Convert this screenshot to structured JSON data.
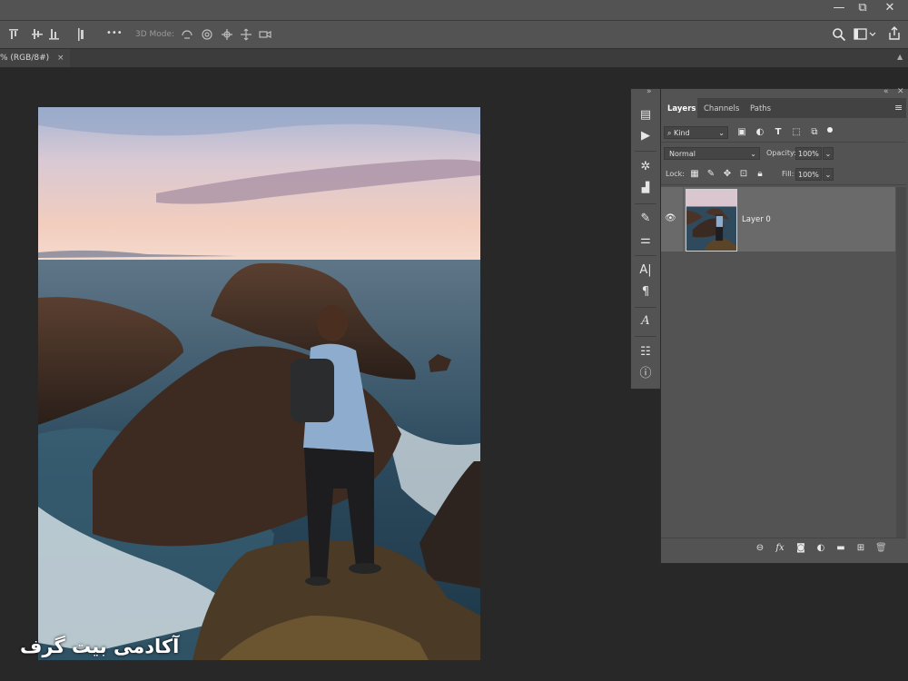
{
  "window": {
    "minimize": "—",
    "restore": "⧉",
    "close": "✕"
  },
  "options_bar": {
    "more_label": "•••",
    "mode_label": "3D Mode:"
  },
  "doc_tab": {
    "title": "% (RGB/8#)",
    "close": "×"
  },
  "panel_dock": {
    "collapse": "»",
    "items": [
      "history",
      "actions",
      "nav",
      "histogram",
      "brushes",
      "brush-settings",
      "character",
      "paragraph",
      "glyphs",
      "properties",
      "info"
    ]
  },
  "layers_panel": {
    "collapse": "«",
    "close": "✕",
    "menu": "≡",
    "tabs": [
      "Layers",
      "Channels",
      "Paths"
    ],
    "filter": {
      "kind": "Kind"
    },
    "blend_mode": "Normal",
    "opacity_label": "Opacity:",
    "opacity_value": "100%",
    "lock_label": "Lock:",
    "fill_label": "Fill:",
    "fill_value": "100%",
    "layers": [
      {
        "name": "Layer 0",
        "visible": true
      }
    ]
  },
  "watermark": "آکادمی بیت گرف",
  "colors": {
    "ui": "#535353",
    "dark": "#282828",
    "selected_layer": "#6a6a6a"
  }
}
